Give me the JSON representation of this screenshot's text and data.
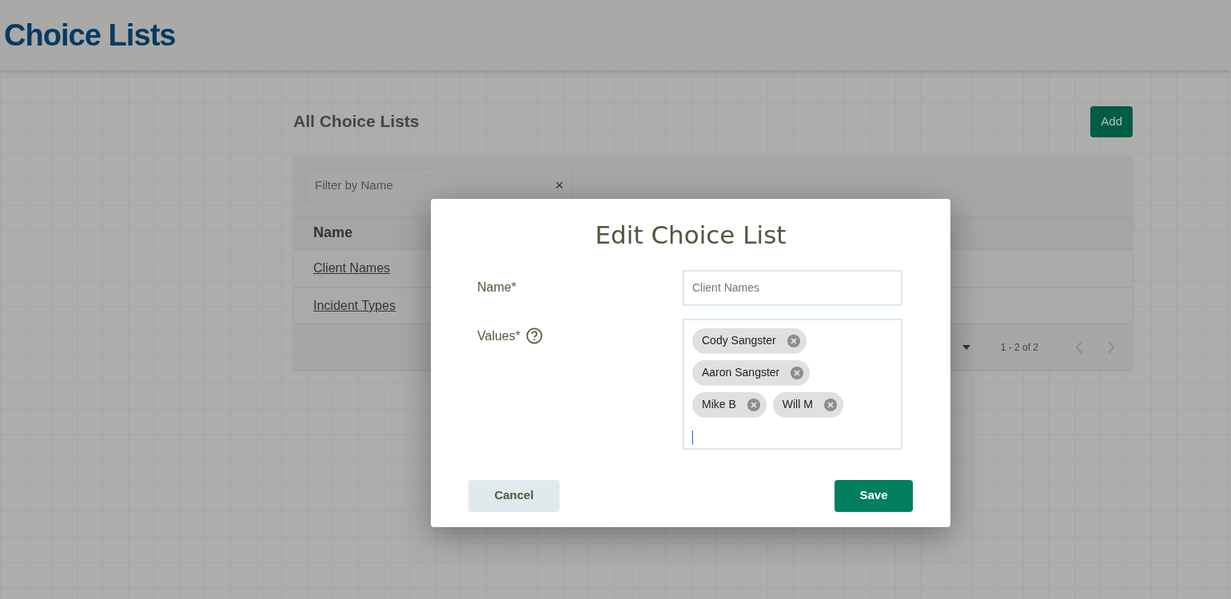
{
  "page_title": "Choice Lists",
  "section_title": "All Choice Lists",
  "add_button": "Add",
  "filter": {
    "placeholder": "Filter by Name",
    "clear": "×"
  },
  "table": {
    "columns": [
      "Name"
    ],
    "rows": [
      {
        "name": "Client Names"
      },
      {
        "name": "Incident Types"
      }
    ],
    "pagination": "1 - 2 of 2"
  },
  "dialog": {
    "title": "Edit Choice List",
    "fields": [
      {
        "kind": "text",
        "label": "Name*",
        "placeholder": "Client Names",
        "help": false
      },
      {
        "kind": "chips",
        "label": "Values*",
        "help": true,
        "chips": [
          "Cody Sangster",
          "Aaron Sangster",
          "Mike B",
          "Will M"
        ]
      }
    ],
    "cancel": "Cancel",
    "save": "Save"
  }
}
